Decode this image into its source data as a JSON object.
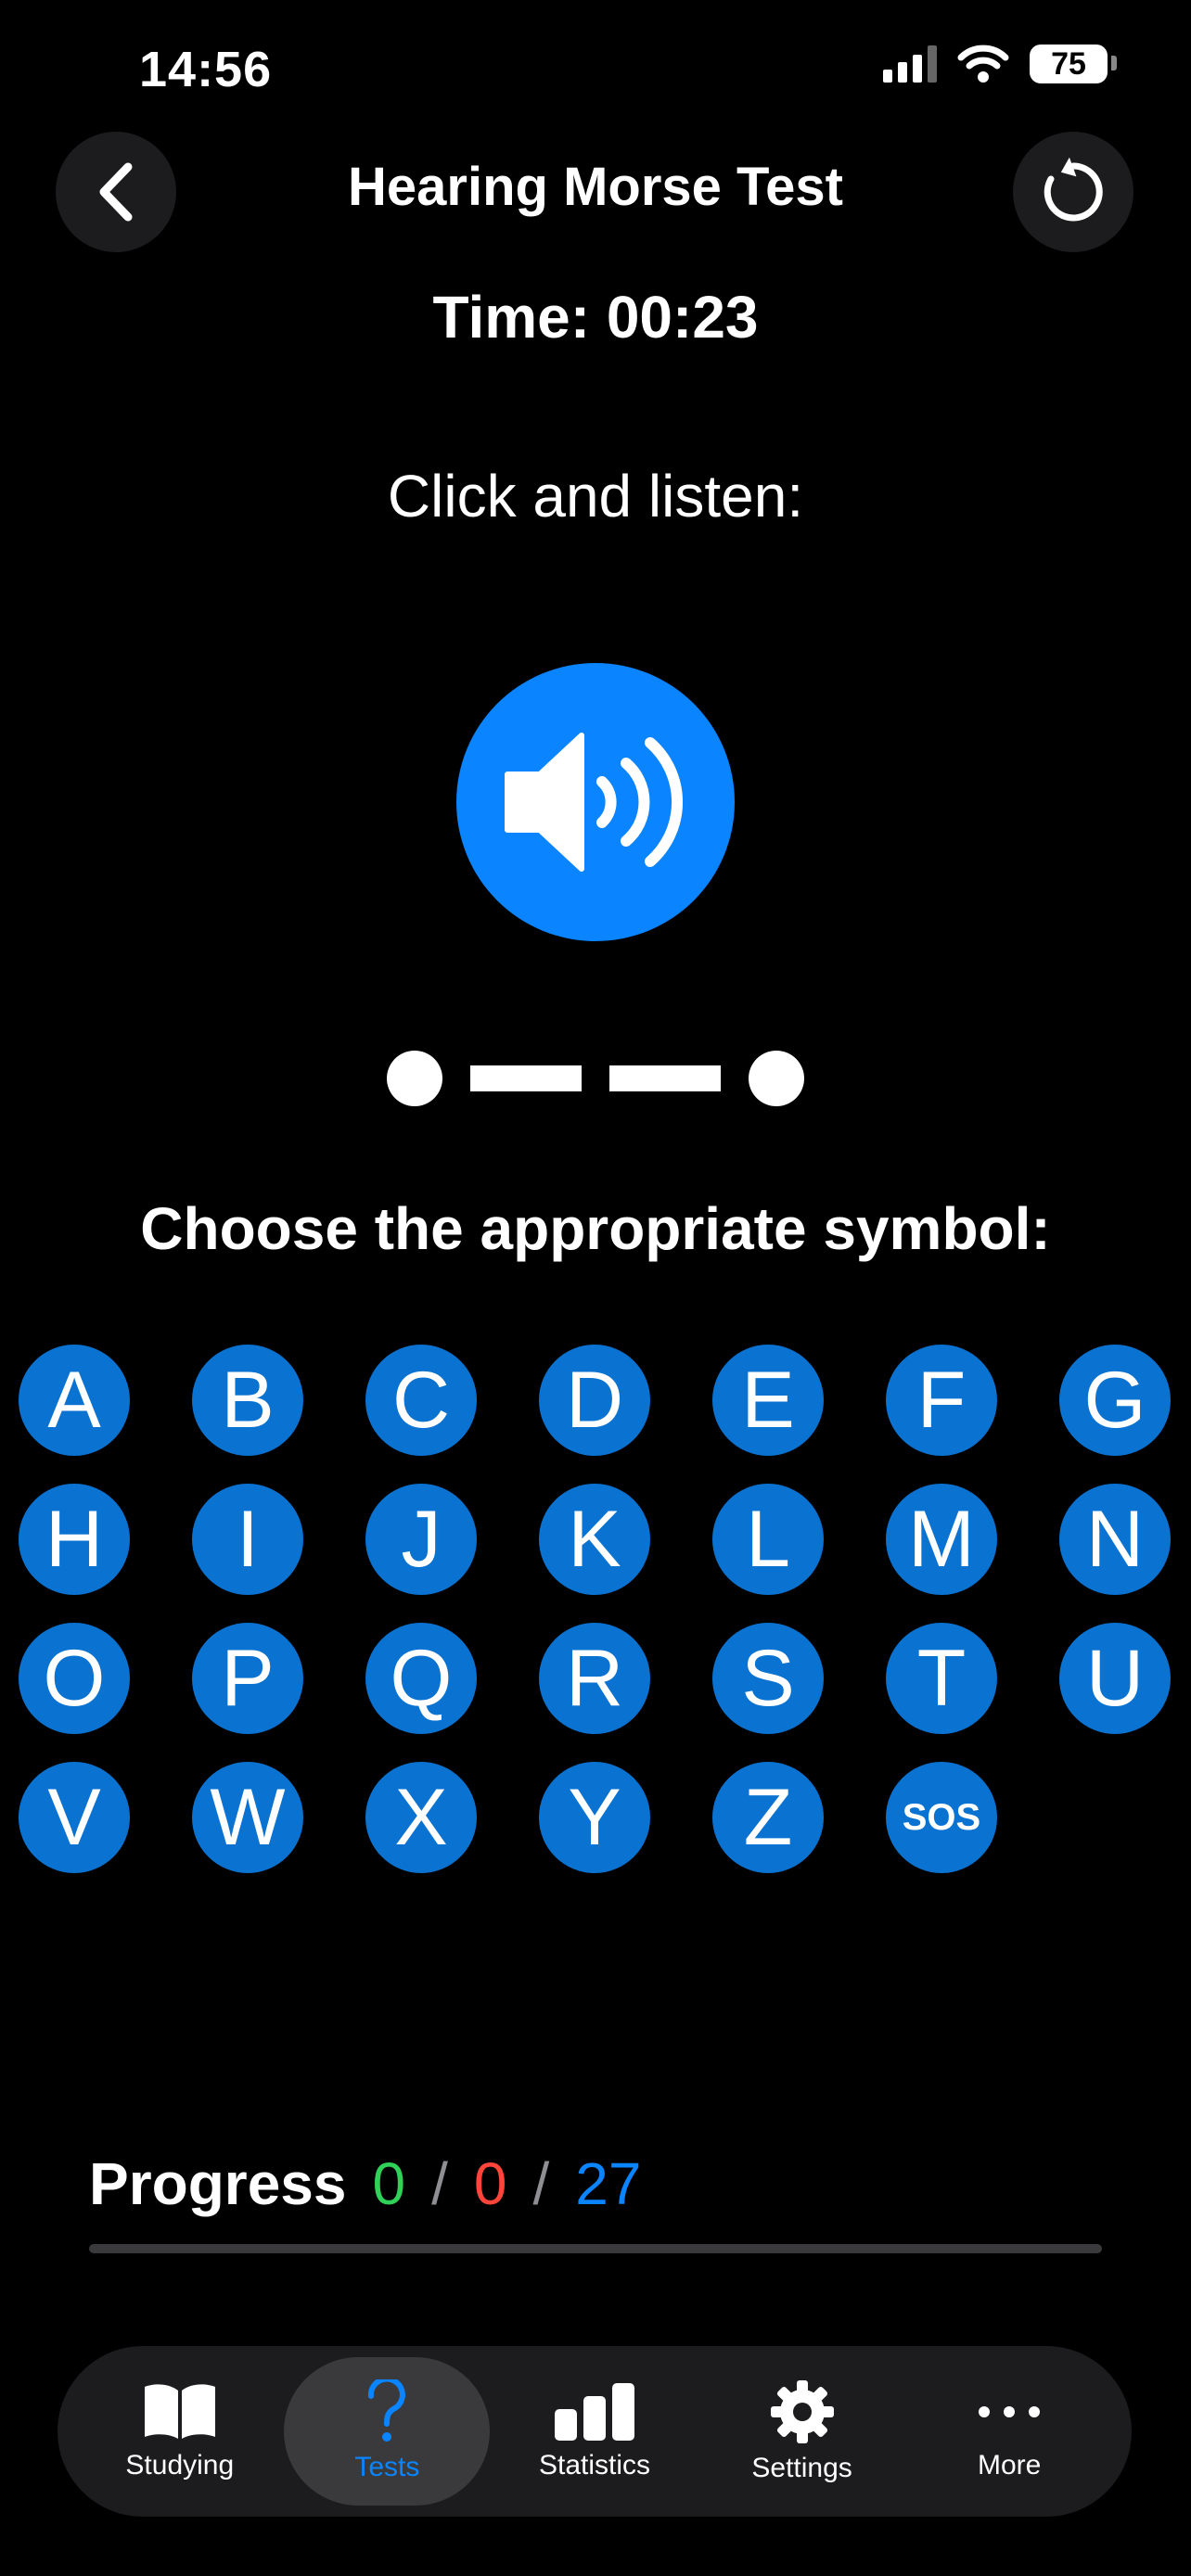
{
  "status": {
    "time": "14:56",
    "battery": "75"
  },
  "header": {
    "title": "Hearing Morse Test",
    "timer": "Time: 00:23"
  },
  "prompt": {
    "listen": "Click and listen:",
    "choose": "Choose the appropriate symbol:"
  },
  "morse": [
    "dot",
    "dash",
    "dash",
    "dot"
  ],
  "keys": [
    "A",
    "B",
    "C",
    "D",
    "E",
    "F",
    "G",
    "H",
    "I",
    "J",
    "K",
    "L",
    "M",
    "N",
    "O",
    "P",
    "Q",
    "R",
    "S",
    "T",
    "U",
    "V",
    "W",
    "X",
    "Y",
    "Z",
    "SOS"
  ],
  "progress": {
    "label": "Progress",
    "correct": "0",
    "wrong": "0",
    "total": "27",
    "sep": "/",
    "fraction": 0
  },
  "tabs": [
    {
      "label": "Studying",
      "icon": "book-icon"
    },
    {
      "label": "Tests",
      "icon": "question-icon"
    },
    {
      "label": "Statistics",
      "icon": "bar-chart-icon"
    },
    {
      "label": "Settings",
      "icon": "gear-icon"
    },
    {
      "label": "More",
      "icon": "ellipsis-icon"
    }
  ],
  "colors": {
    "accent": "#0a84ff",
    "key": "#0a72d1",
    "correct": "#30d158",
    "wrong": "#ff453a"
  }
}
